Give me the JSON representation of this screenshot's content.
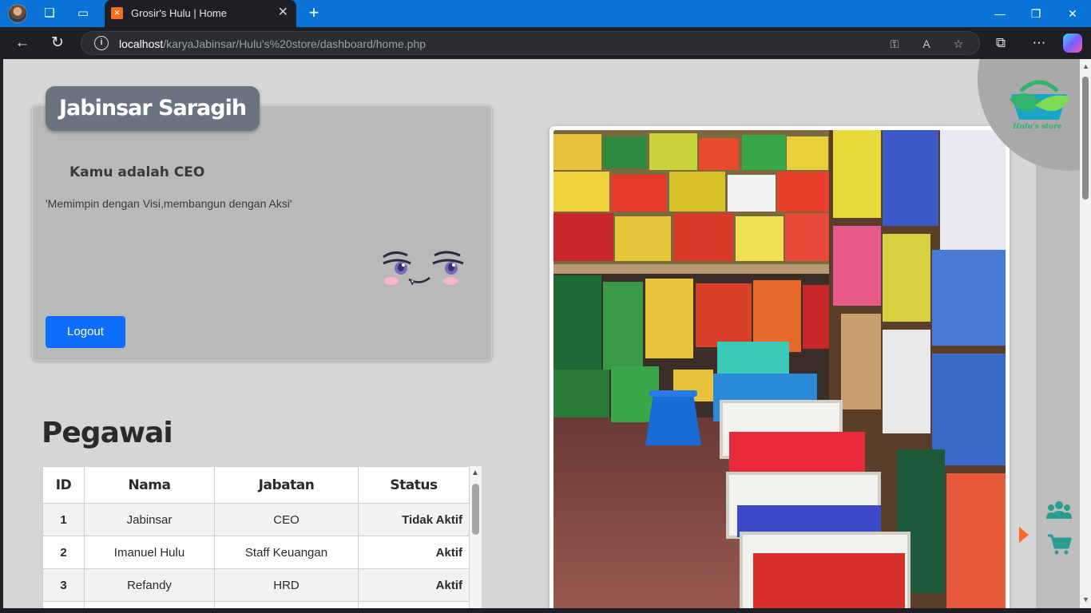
{
  "browser": {
    "tab_title": "Grosir's Hulu | Home",
    "tab_favicon": "XAMPP",
    "url_host": "localhost",
    "url_path": "/karyaJabinsar/Hulu's%20store/dashboard/home.php"
  },
  "profile": {
    "name": "Jabinsar Saragih",
    "role_text": "Kamu adalah CEO",
    "motto": "'Memimpin dengan Visi,membangun dengan Aksi'",
    "logout_label": "Logout"
  },
  "employees": {
    "title": "Pegawai",
    "headers": [
      "ID",
      "Nama",
      "Jabatan",
      "Status"
    ],
    "rows": [
      {
        "id": "1",
        "nama": "Jabinsar",
        "jabatan": "CEO",
        "status": "Tidak Aktif"
      },
      {
        "id": "2",
        "nama": "Imanuel Hulu",
        "jabatan": "Staff Keuangan",
        "status": "Aktif"
      },
      {
        "id": "3",
        "nama": "Refandy",
        "jabatan": "HRD",
        "status": "Aktif"
      }
    ]
  },
  "brand": {
    "logo_text": "Hulu's store"
  },
  "icons": {
    "users": "users-icon",
    "cart": "cart-icon",
    "arrow": "arrow-right-icon"
  },
  "colors": {
    "accent": "#0d6efd",
    "brand_green": "#2fb36d",
    "brand_teal": "#1ba6c9",
    "arrow": "#ff6a2a"
  }
}
